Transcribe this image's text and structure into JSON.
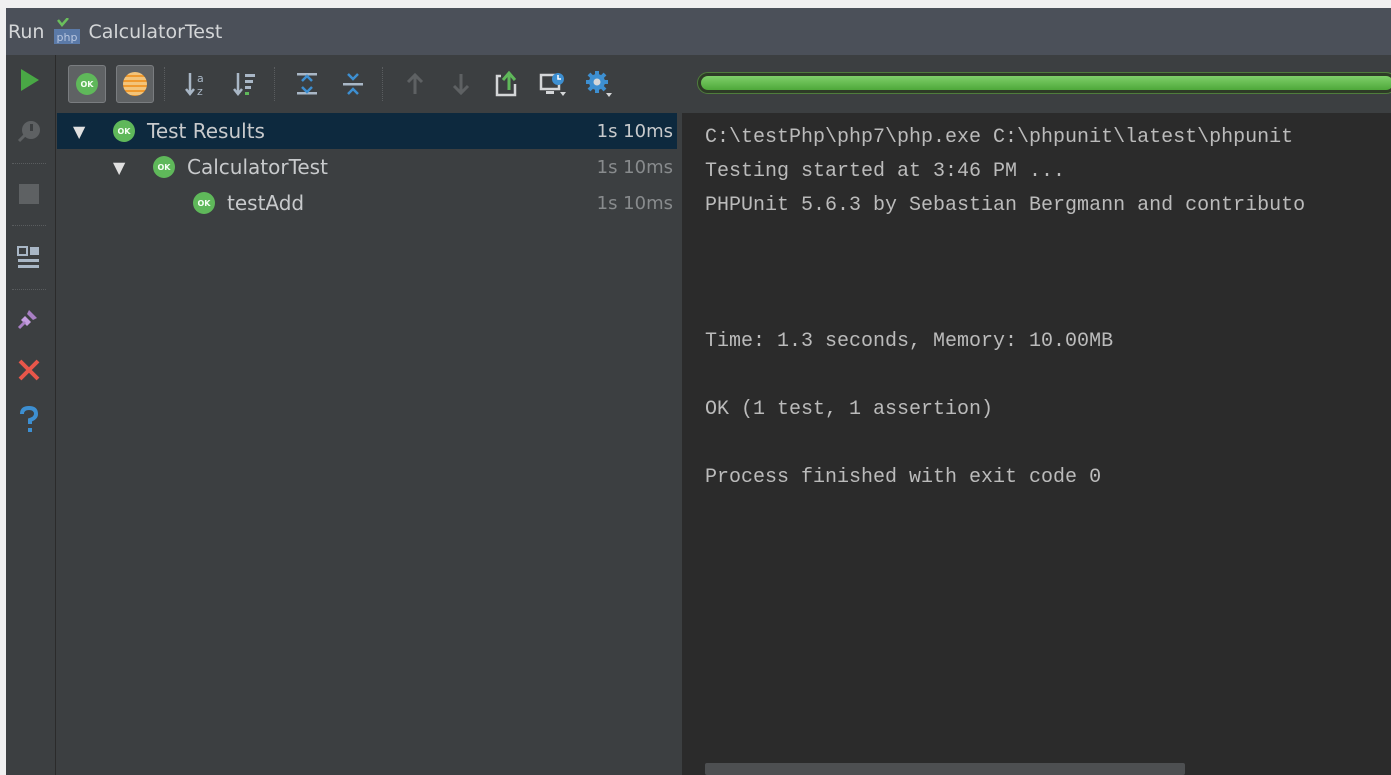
{
  "title_bar": {
    "run_label": "Run",
    "config_name": "CalculatorTest"
  },
  "vertical_toolbar": {
    "items": [
      {
        "icon": "rerun-icon",
        "color": "#49a845"
      },
      {
        "icon": "rerun-failed-icon",
        "color": "#5e6163"
      },
      {
        "icon": "stop-icon",
        "color": "#5e6163"
      },
      {
        "icon": "layout-icon",
        "color": "#a9b7c6"
      },
      {
        "icon": "pin-icon",
        "color": "#a87fc4"
      },
      {
        "icon": "close-icon",
        "color": "#e8564a"
      },
      {
        "icon": "help-icon",
        "color": "#3d8fd1"
      }
    ]
  },
  "horizontal_toolbar": {
    "items": [
      {
        "icon": "show-passed-icon",
        "toggled": true
      },
      {
        "icon": "show-ignored-icon",
        "toggled": true
      },
      {
        "icon": "sort-alphabetically-icon"
      },
      {
        "icon": "sort-by-duration-icon"
      },
      {
        "icon": "expand-all-icon"
      },
      {
        "icon": "collapse-all-icon"
      },
      {
        "icon": "previous-failed-icon"
      },
      {
        "icon": "next-failed-icon"
      },
      {
        "icon": "export-results-icon"
      },
      {
        "icon": "import-results-icon"
      },
      {
        "icon": "settings-icon"
      }
    ],
    "progress": 1.0,
    "progress_color": "#5fb85a"
  },
  "tree": {
    "rows": [
      {
        "label": "Test Results",
        "time": "1s 10ms",
        "status": "OK",
        "expanded": true,
        "selected": true
      },
      {
        "label": "CalculatorTest",
        "time": "1s 10ms",
        "status": "OK",
        "expanded": true,
        "selected": false
      },
      {
        "label": "testAdd",
        "time": "1s 10ms",
        "status": "OK",
        "selected": false
      }
    ]
  },
  "console": {
    "lines": [
      "C:\\testPhp\\php7\\php.exe C:\\phpunit\\latest\\phpunit",
      "Testing started at 3:46 PM ...",
      "PHPUnit 5.6.3 by Sebastian Bergmann and contributo",
      "",
      "",
      "",
      "Time: 1.3 seconds, Memory: 10.00MB",
      "",
      "OK (1 test, 1 assertion)",
      "",
      "Process finished with exit code 0"
    ]
  }
}
